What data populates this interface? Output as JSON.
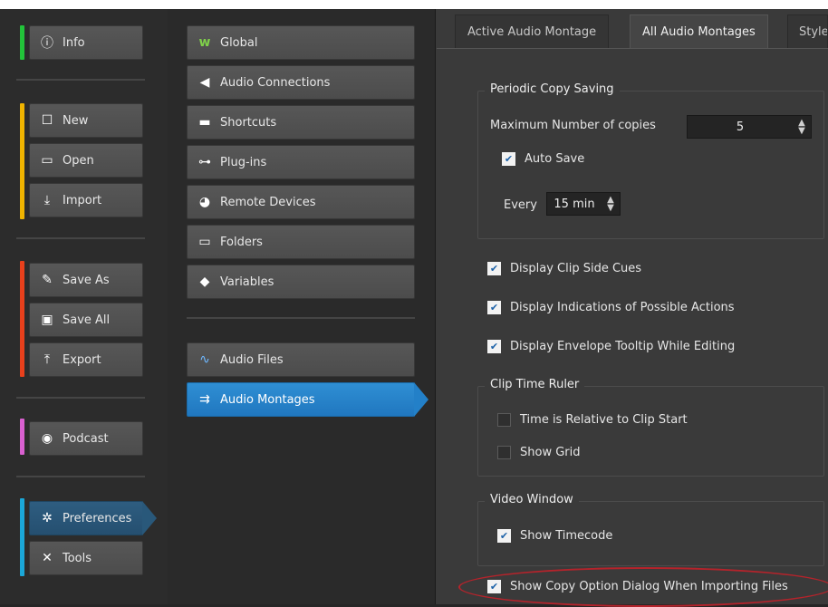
{
  "left_nav": {
    "info": "Info",
    "new": "New",
    "open": "Open",
    "import": "Import",
    "save_as": "Save As",
    "save_all": "Save All",
    "export": "Export",
    "podcast": "Podcast",
    "preferences": "Preferences",
    "tools": "Tools"
  },
  "categories": {
    "global": "Global",
    "audio_connections": "Audio Connections",
    "shortcuts": "Shortcuts",
    "plugins": "Plug-ins",
    "remote_devices": "Remote Devices",
    "folders": "Folders",
    "variables": "Variables",
    "audio_files": "Audio Files",
    "audio_montages": "Audio Montages"
  },
  "tabs": {
    "active": "Active Audio Montage",
    "all": "All Audio Montages",
    "style": "Style"
  },
  "periodic": {
    "title": "Periodic Copy Saving",
    "max_label": "Maximum Number of copies",
    "max_value": "5",
    "auto_save_label": "Auto Save",
    "auto_save_checked": true,
    "every_label": "Every",
    "every_value": "15 min"
  },
  "options": {
    "clip_side_cues": "Display Clip Side Cues",
    "possible_actions": "Display Indications of Possible Actions",
    "envelope_tooltip": "Display Envelope Tooltip While Editing"
  },
  "clip_time_ruler": {
    "title": "Clip Time Ruler",
    "relative": "Time is Relative to Clip Start",
    "show_grid": "Show Grid"
  },
  "video": {
    "title": "Video Window",
    "show_timecode": "Show Timecode"
  },
  "copy_option": "Show Copy Option Dialog When Importing Files",
  "accent_colors": {
    "info": "#22c33a",
    "file": "#f0b400",
    "save": "#e8401c",
    "podcast": "#d960d0",
    "prefs": "#1ba7d8",
    "selection": "#2380c8",
    "highlight": "#b5232b"
  }
}
